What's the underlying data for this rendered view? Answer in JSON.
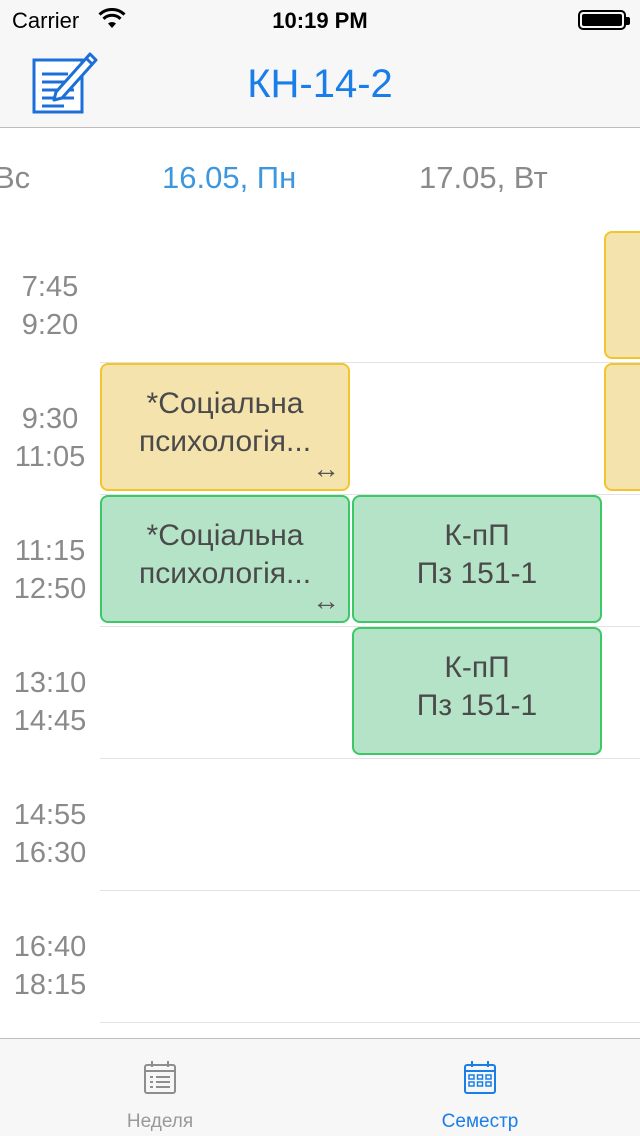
{
  "status_bar": {
    "carrier": "Carrier",
    "time": "10:19 PM"
  },
  "nav": {
    "title": "КН-14-2",
    "edit_icon": "edit-schedule-icon"
  },
  "dates": [
    {
      "label": "Вс",
      "active": false
    },
    {
      "label": "16.05, Пн",
      "active": true
    },
    {
      "label": "17.05, Вт",
      "active": false
    }
  ],
  "time_slots": [
    {
      "start": "7:45",
      "end": "9:20"
    },
    {
      "start": "9:30",
      "end": "11:05"
    },
    {
      "start": "11:15",
      "end": "12:50"
    },
    {
      "start": "13:10",
      "end": "14:45"
    },
    {
      "start": "14:55",
      "end": "16:30"
    },
    {
      "start": "16:40",
      "end": "18:15"
    }
  ],
  "events": [
    {
      "title": "*Соціальна",
      "subtitle": "психологія...",
      "day": "16.05, Пн",
      "slot": "9:30",
      "color": "#f5e3ad",
      "arrow": "↔"
    },
    {
      "title": "*Соціальна",
      "subtitle": "психологія...",
      "day": "16.05, Пн",
      "slot": "11:15",
      "color": "#b5e3c8",
      "arrow": "↔"
    },
    {
      "title": "К-пП",
      "subtitle": "Пз 151-1",
      "day": "17.05, Вт",
      "slot": "11:15",
      "color": "#b5e3c8"
    },
    {
      "title": "К-пП",
      "subtitle": "Пз 151-1",
      "day": "17.05, Вт",
      "slot": "13:10",
      "color": "#b5e3c8"
    }
  ],
  "tabs": [
    {
      "label": "Неделя",
      "icon": "week-list-icon",
      "active": false
    },
    {
      "label": "Семестр",
      "icon": "semester-calendar-icon",
      "active": true
    }
  ]
}
